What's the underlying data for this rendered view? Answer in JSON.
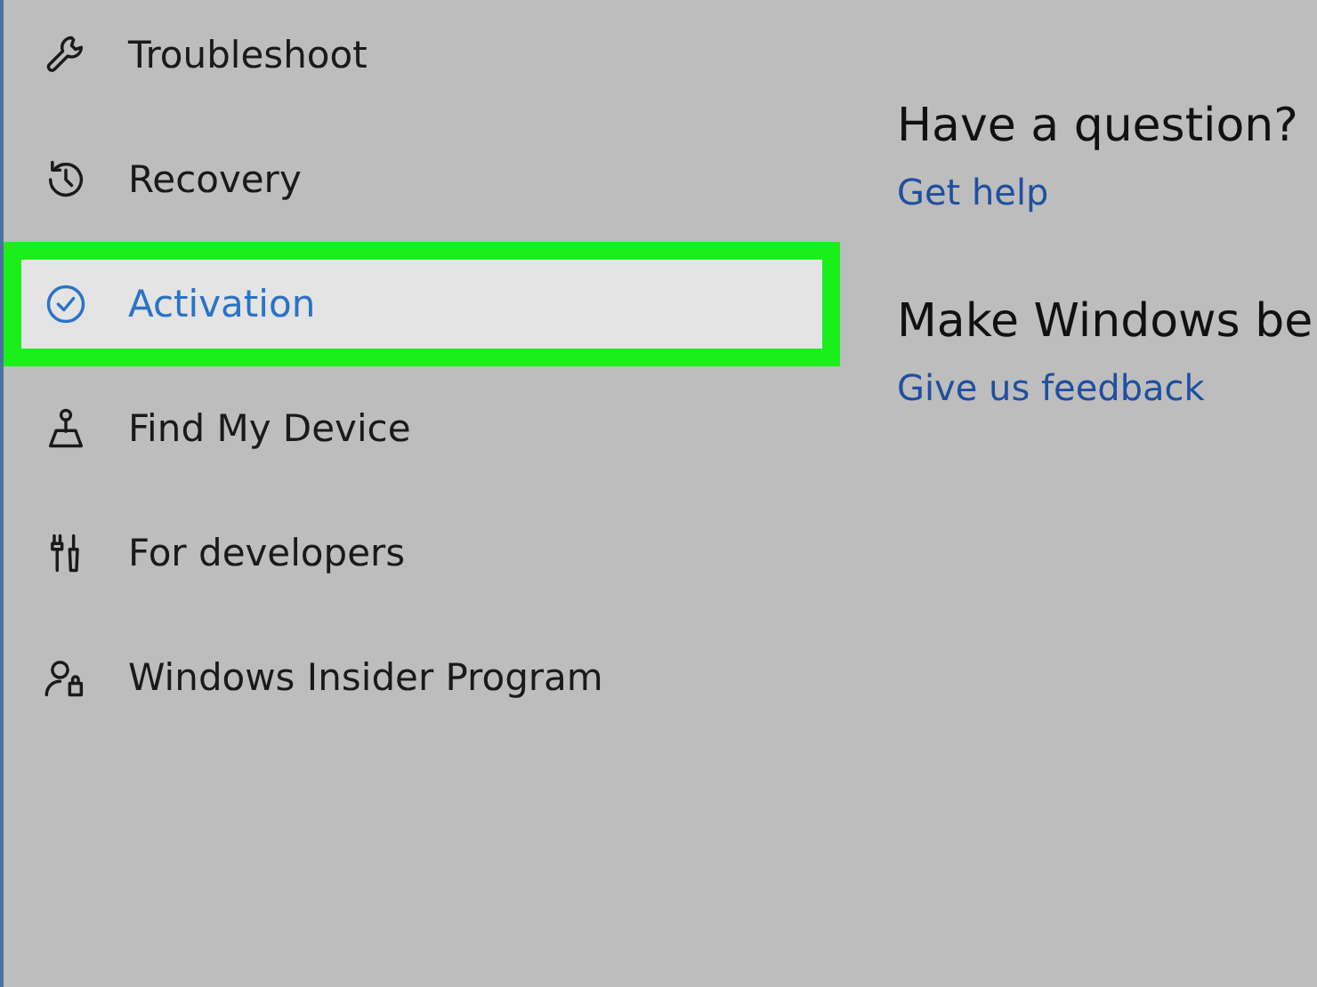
{
  "sidebar": {
    "items": [
      {
        "label": "Troubleshoot",
        "selected": false
      },
      {
        "label": "Recovery",
        "selected": false
      },
      {
        "label": "Activation",
        "selected": true
      },
      {
        "label": "Find My Device",
        "selected": false
      },
      {
        "label": "For developers",
        "selected": false
      },
      {
        "label": "Windows Insider Program",
        "selected": false
      }
    ]
  },
  "help": {
    "sections": [
      {
        "heading": "Have a question?",
        "link": "Get help"
      },
      {
        "heading": "Make Windows be",
        "link": "Give us feedback"
      }
    ]
  }
}
